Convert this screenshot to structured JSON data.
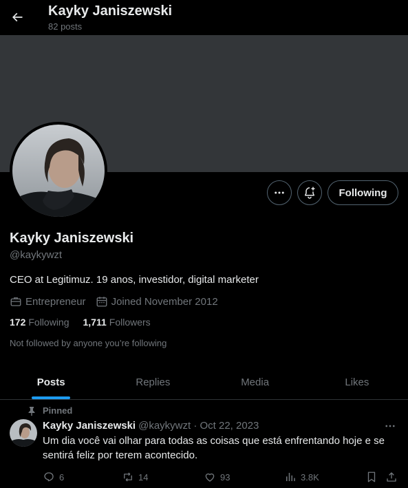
{
  "header": {
    "name": "Kayky Janiszewski",
    "posts_count": "82 posts"
  },
  "profile": {
    "display_name": "Kayky Janiszewski",
    "handle": "@kaykywzt",
    "bio": "CEO at Legitimuz. 19 anos, investidor, digital marketer",
    "category": "Entrepreneur",
    "joined": "Joined November 2012",
    "following_count": "172",
    "following_label": "Following",
    "followers_count": "1,711",
    "followers_label": "Followers",
    "not_followed_note": "Not followed by anyone you’re following",
    "follow_button_label": "Following"
  },
  "tabs": [
    {
      "label": "Posts",
      "active": true
    },
    {
      "label": "Replies",
      "active": false
    },
    {
      "label": "Media",
      "active": false
    },
    {
      "label": "Likes",
      "active": false
    }
  ],
  "post": {
    "pinned_label": "Pinned",
    "author": "Kayky Janiszewski",
    "handle_date": "@kaykywzt · Oct 22, 2023",
    "text": "Um dia você vai olhar para todas as coisas que está enfrentando hoje e se sentirá feliz por terem acontecido.",
    "replies": "6",
    "reposts": "14",
    "likes": "93",
    "views": "3.8K"
  },
  "colors": {
    "background": "#000000",
    "banner": "#333639",
    "accent": "#1d9bf0",
    "muted_text": "#71767b",
    "primary_text": "#e7e9ea",
    "border": "#2f3336"
  },
  "icons": [
    "back-arrow-icon",
    "more-icon",
    "notification-bell-icon",
    "briefcase-icon",
    "calendar-icon",
    "pin-icon",
    "reply-icon",
    "repost-icon",
    "like-icon",
    "views-icon",
    "bookmark-icon",
    "share-icon"
  ]
}
